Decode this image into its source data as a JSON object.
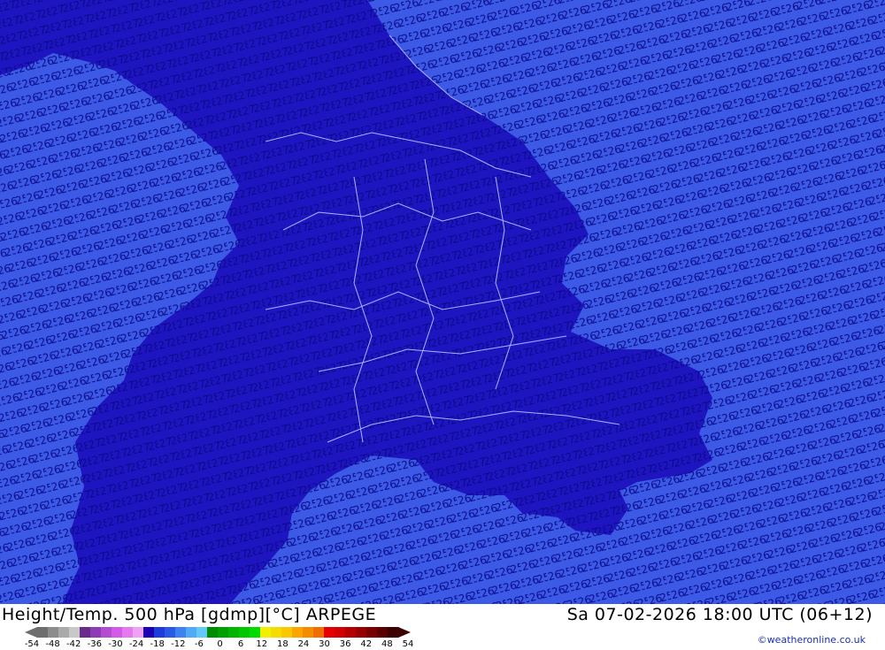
{
  "title": {
    "left": "Height/Temp. 500 hPa [gdmp][°C] ARPEGE",
    "right": "Sa 07-02-2026 18:00 UTC (06+12)"
  },
  "map": {
    "contour_labels": [
      "25",
      "26",
      "27",
      "28"
    ],
    "colors": {
      "ocean_fill": "#3c5ae6",
      "land_fill": "#1e14c0",
      "contour_lines": "#0a0a8c",
      "borders": "#a9b4ff"
    }
  },
  "colorbar": {
    "tick_labels": [
      "-54",
      "-48",
      "-42",
      "-36",
      "-30",
      "-24",
      "-18",
      "-12",
      "-6",
      "0",
      "6",
      "12",
      "18",
      "24",
      "30",
      "36",
      "42",
      "48",
      "54"
    ],
    "colors": [
      "#6e6e6e",
      "#8c8c8c",
      "#aaaaaa",
      "#c8c8c8",
      "#6a2a8c",
      "#8c3cb4",
      "#b44cd2",
      "#d25ae6",
      "#e678f0",
      "#f0a0f5",
      "#1e00b4",
      "#1e3cdc",
      "#285ae6",
      "#3c82f0",
      "#50aaf5",
      "#64c8fa",
      "#008c00",
      "#00a000",
      "#00b400",
      "#00c800",
      "#00dc00",
      "#f0f000",
      "#f5dc00",
      "#fac800",
      "#faa500",
      "#f58c00",
      "#f06e00",
      "#e60000",
      "#d20000",
      "#b40000",
      "#960000",
      "#780000",
      "#5a0000",
      "#3c0000"
    ]
  },
  "credit": "©weatheronline.co.uk"
}
